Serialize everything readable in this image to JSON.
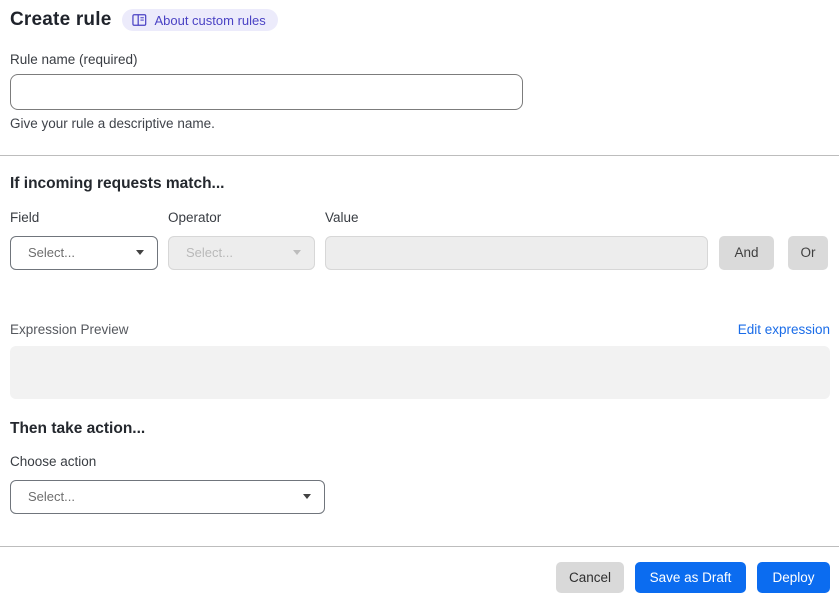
{
  "page": {
    "title": "Create rule",
    "about_label": "About custom rules"
  },
  "rule_name": {
    "label": "Rule name (required)",
    "value": "",
    "help": "Give your rule a descriptive name."
  },
  "match": {
    "heading": "If incoming requests match...",
    "field_label": "Field",
    "operator_label": "Operator",
    "value_label": "Value",
    "field_placeholder": "Select...",
    "operator_placeholder": "Select...",
    "value_value": "",
    "and_label": "And",
    "or_label": "Or"
  },
  "expression": {
    "label": "Expression Preview",
    "edit_link": "Edit expression",
    "preview_text": ""
  },
  "action": {
    "heading": "Then take action...",
    "label": "Choose action",
    "placeholder": "Select..."
  },
  "footer": {
    "cancel_label": "Cancel",
    "save_draft_label": "Save as Draft",
    "deploy_label": "Deploy"
  },
  "colors": {
    "primary_button_blue": "#0b6cf0",
    "link_blue": "#1a6ce8",
    "badge_bg": "#ecebfb",
    "badge_text": "#4a42c4",
    "disabled_bg": "#ededed",
    "secondary_button_gray": "#d9d9d9"
  },
  "icons": {
    "about": "book-icon",
    "selects": "chevron-down-icon"
  }
}
